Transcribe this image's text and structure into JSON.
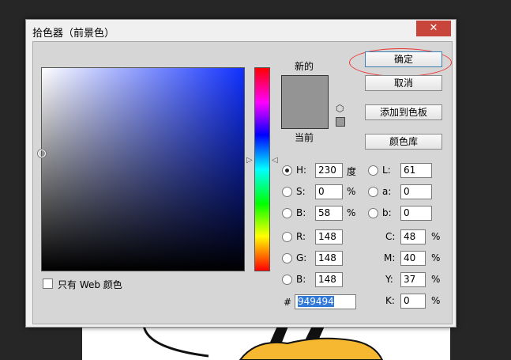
{
  "dialog": {
    "title": "拾色器（前景色）",
    "close_glyph": "✕"
  },
  "colors": {
    "current": "#949494",
    "field_hue": "#1030ff"
  },
  "swatch": {
    "new_label": "新的",
    "current_label": "当前",
    "cube_icon": "3d-cube",
    "websafe_icon": "websafe-swatch"
  },
  "buttons": {
    "ok": "确定",
    "cancel": "取消",
    "add_to_swatches": "添加到色板",
    "color_libraries": "颜色库"
  },
  "hsb": {
    "h": {
      "label": "H:",
      "value": "230",
      "unit": "度"
    },
    "s": {
      "label": "S:",
      "value": "0",
      "unit": "%"
    },
    "b": {
      "label": "B:",
      "value": "58",
      "unit": "%"
    }
  },
  "lab": {
    "l": {
      "label": "L:",
      "value": "61"
    },
    "a": {
      "label": "a:",
      "value": "0"
    },
    "b": {
      "label": "b:",
      "value": "0"
    }
  },
  "rgb": {
    "r": {
      "label": "R:",
      "value": "148"
    },
    "g": {
      "label": "G:",
      "value": "148"
    },
    "b": {
      "label": "B:",
      "value": "148"
    }
  },
  "cmyk": {
    "c": {
      "label": "C:",
      "value": "48",
      "unit": "%"
    },
    "m": {
      "label": "M:",
      "value": "40",
      "unit": "%"
    },
    "y": {
      "label": "Y:",
      "value": "37",
      "unit": "%"
    },
    "k": {
      "label": "K:",
      "value": "0",
      "unit": "%"
    }
  },
  "hex": {
    "label": "#",
    "value": "949494"
  },
  "web_only": {
    "label": "只有 Web 颜色"
  }
}
